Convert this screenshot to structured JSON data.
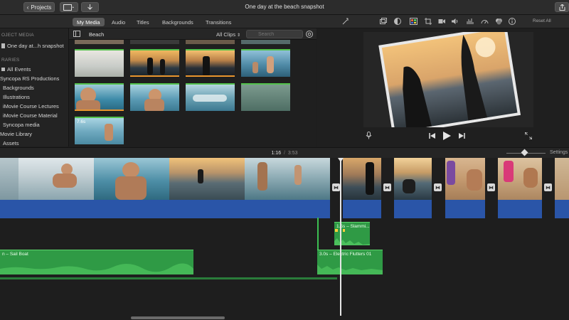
{
  "titlebar": {
    "back_label": "Projects",
    "window_title": "One day at the beach snapshot"
  },
  "toolbar": {
    "tabs": [
      {
        "label": "My Media",
        "active": true
      },
      {
        "label": "Audio",
        "active": false
      },
      {
        "label": "Titles",
        "active": false
      },
      {
        "label": "Backgrounds",
        "active": false
      },
      {
        "label": "Transitions",
        "active": false
      }
    ],
    "adjust_icons": [
      "magic-wand-icon",
      "crop-frame-icon",
      "color-balance-icon",
      "color-palette-icon",
      "crop-icon",
      "camera-stabilize-icon",
      "volume-icon",
      "equalizer-icon",
      "speed-icon",
      "filter-icon",
      "info-icon"
    ],
    "reset_all_label": "Reset All"
  },
  "sidebar": {
    "project_media_heading": "OJECT MEDIA",
    "project_item": "One day at...h snapshot",
    "libraries_heading": "RARIES",
    "items": [
      {
        "label": "All Events",
        "indent": 1
      },
      {
        "label": "Syncopa RS Productions",
        "indent": 0
      },
      {
        "label": "Backgrounds",
        "indent": 2
      },
      {
        "label": "Illustrations",
        "indent": 2
      },
      {
        "label": "iMovie Course Lectures",
        "indent": 2
      },
      {
        "label": "iMovie Course Material",
        "indent": 2
      },
      {
        "label": "Syncopa media",
        "indent": 2
      },
      {
        "label": "Movie Library",
        "indent": 0
      },
      {
        "label": "Assets",
        "indent": 2
      }
    ]
  },
  "browser": {
    "event_title": "Beach",
    "filter_label": "All Clips",
    "search_placeholder": "Search",
    "duration_badge": "7.6s"
  },
  "viewer": {
    "controls": [
      "microphone-icon",
      "skip-back-icon",
      "play-icon",
      "skip-forward-icon",
      "fullscreen-icon"
    ]
  },
  "timeline": {
    "current_time": "1:16",
    "total_time": "3:53",
    "settings_label": "Settings",
    "audio_clips": [
      {
        "label": "n – Sail Boat"
      },
      {
        "label": "3.0s – Electric Flutters 01"
      },
      {
        "label": "1.5s – Slammi..."
      }
    ]
  }
}
